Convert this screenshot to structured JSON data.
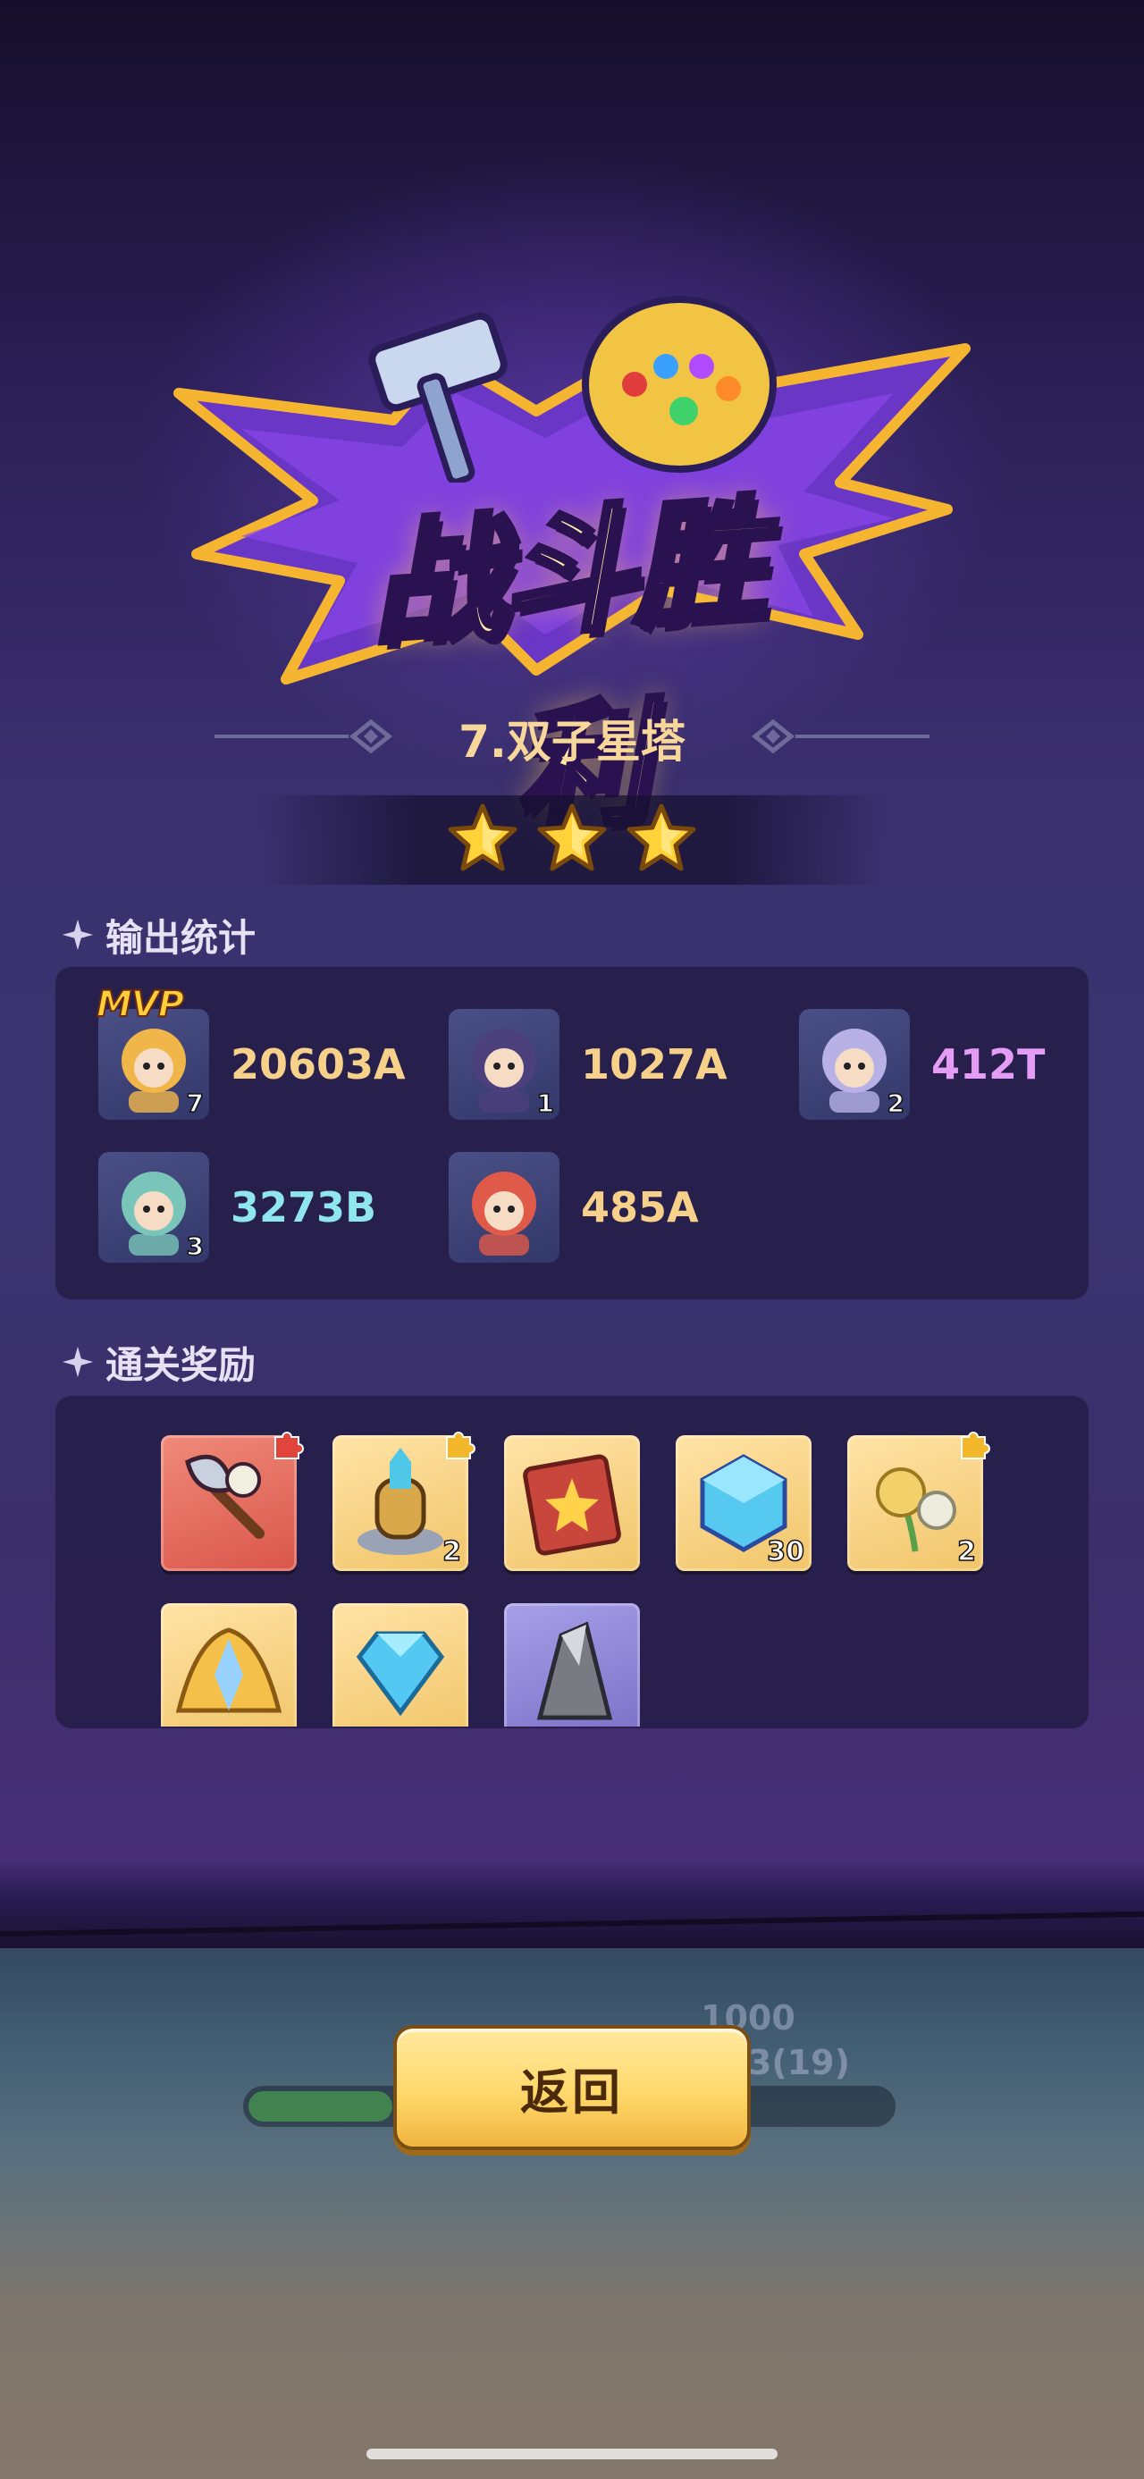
{
  "banner": {
    "title": "战斗胜利"
  },
  "level": {
    "title": "7.双子星塔",
    "stars": 3
  },
  "damage_section": {
    "label": "输出统计",
    "mvp_label": "MVP",
    "heroes": [
      {
        "level": "7",
        "damage": "20603A",
        "color": "#f7d18a",
        "mvp": true
      },
      {
        "level": "1",
        "damage": "1027A",
        "color": "#f7d18a"
      },
      {
        "level": "2",
        "damage": "412T",
        "color": "#e59cf5"
      },
      {
        "level": "3",
        "damage": "3273B",
        "color": "#8fe6ef"
      },
      {
        "level": "",
        "damage": "485A",
        "color": "#f7d18a"
      }
    ]
  },
  "rewards_section": {
    "label": "通关奖励",
    "items": [
      {
        "icon": "axe-fragment-icon",
        "count": ""
      },
      {
        "icon": "helmet-tower-fragment-icon",
        "count": "2"
      },
      {
        "icon": "spellbook-icon",
        "count": ""
      },
      {
        "icon": "energy-cube-icon",
        "count": "30"
      },
      {
        "icon": "flower-fragment-icon",
        "count": "2"
      },
      {
        "icon": "winged-emblem-icon",
        "count": ""
      },
      {
        "icon": "diamond-icon",
        "count": ""
      },
      {
        "icon": "stone-shard-icon",
        "count": ""
      }
    ]
  },
  "background_ui": {
    "counter_top": "1000",
    "counter_bottom": "993(19)",
    "hp_fraction": 0.22
  },
  "actions": {
    "back_label": "返回"
  }
}
